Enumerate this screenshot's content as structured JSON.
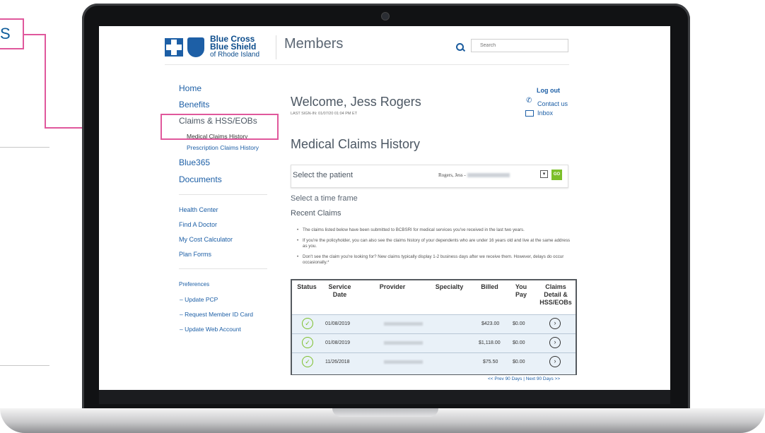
{
  "callout_text": "S",
  "header": {
    "logo_line1": "Blue Cross",
    "logo_line2": "Blue Shield",
    "logo_line3": "of Rhode Island",
    "members_label": "Members",
    "search_placeholder": "Search"
  },
  "sidebar": {
    "main_items": [
      "Home",
      "Benefits",
      "Claims & HSS/EOBs",
      "Blue365",
      "Documents"
    ],
    "claims_sub": [
      "Medical Claims History",
      "Prescription Claims History"
    ],
    "tools": [
      "Health Center",
      "Find A Doctor",
      "My Cost Calculator",
      "Plan Forms"
    ],
    "preferences_label": "Preferences",
    "preferences": [
      "Update PCP",
      "Request Member ID Card",
      "Update Web Account"
    ]
  },
  "account": {
    "welcome": "Welcome, Jess Rogers",
    "last_signin": "LAST SIGN-IN: 01/07/20 01:04 PM ET",
    "logout": "Log out",
    "contact": "Contact us",
    "inbox": "Inbox"
  },
  "main": {
    "title": "Medical Claims History",
    "patient_label": "Select the patient",
    "patient_value": "Rogers, Jess -",
    "go_label": "GO",
    "timeframe_label": "Select a time frame",
    "recent_label": "Recent Claims",
    "bullets": [
      "The claims listed below have been submitted to BCBSRI for medical services you've received in the last two years.",
      "If you're the policyholder, you can also see the claims history of your dependents who are under 16 years old and live at the same address as you.",
      "Don't see the claim you're looking for? New claims typically display 1-2 business days after we receive them. However, delays do occur occasionally.*"
    ]
  },
  "table": {
    "columns": [
      "Status",
      "Service Date",
      "Provider",
      "Specialty",
      "Billed",
      "You Pay",
      "Claims Detail & HSS/EOBs"
    ],
    "rows": [
      {
        "date": "01/08/2019",
        "billed": "$423.00",
        "you_pay": "$0.00"
      },
      {
        "date": "01/08/2019",
        "billed": "$1,118.00",
        "you_pay": "$0.00"
      },
      {
        "date": "11/26/2018",
        "billed": "$75.50",
        "you_pay": "$0.00"
      }
    ]
  },
  "pager": {
    "text": "<< Prev 90 Days | Next 90 Days >>"
  }
}
